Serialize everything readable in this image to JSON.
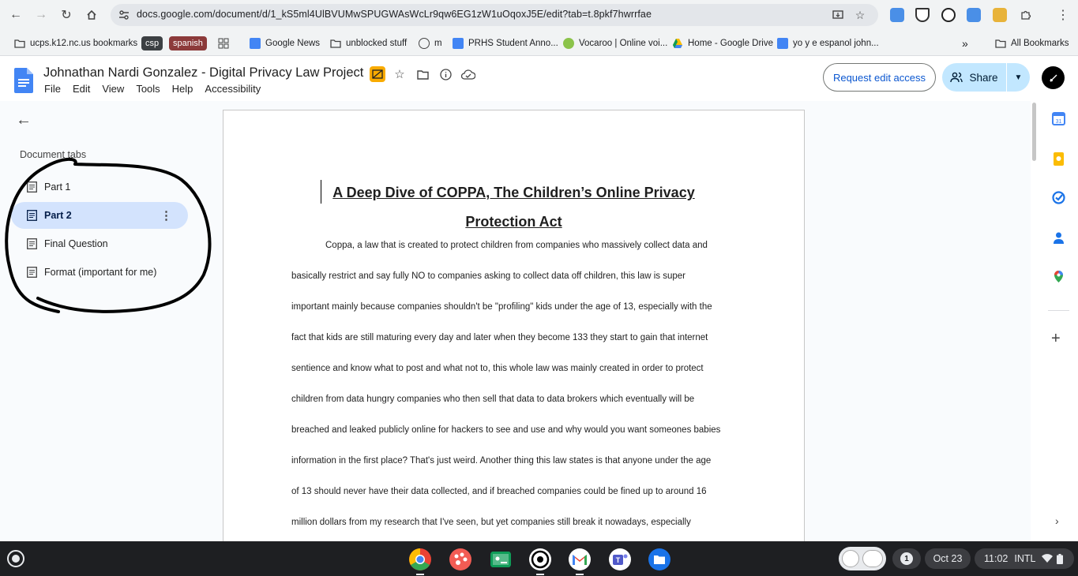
{
  "browser": {
    "url": "docs.google.com/document/d/1_kS5ml4UlBVUMwSPUGWAsWcLr9qw6EG1zW1uOqoxJ5E/edit?tab=t.8pkf7hwrrfae",
    "bookmarks": [
      {
        "label": "ucps.k12.nc.us bookmarks"
      },
      {
        "label": "csp"
      },
      {
        "label": "spanish"
      },
      {
        "label": "Google News"
      },
      {
        "label": "unblocked stuff"
      },
      {
        "label": "m"
      },
      {
        "label": "PRHS Student Anno..."
      },
      {
        "label": "Vocaroo | Online voi..."
      },
      {
        "label": "Home - Google Drive"
      },
      {
        "label": "yo y e espanol john..."
      }
    ],
    "all_bookmarks": "All Bookmarks",
    "overflow": "»"
  },
  "docs": {
    "title": "Johnathan Nardi Gonzalez - Digital Privacy Law Project",
    "menu": [
      "File",
      "Edit",
      "View",
      "Tools",
      "Help",
      "Accessibility"
    ],
    "request_edit": "Request edit access",
    "share": "Share"
  },
  "sidebar": {
    "heading": "Document tabs",
    "tabs": [
      {
        "label": "Part 1",
        "active": false
      },
      {
        "label": "Part 2",
        "active": true
      },
      {
        "label": "Final Question",
        "active": false
      },
      {
        "label": "Format (important for me)",
        "active": false
      }
    ]
  },
  "document": {
    "title_line1": "A Deep Dive of COPPA, The Children’s Online Privacy",
    "title_line2": "Protection Act",
    "lines": [
      "Coppa, a law that is created to protect children from companies who massively collect data and",
      "basically restrict and say fully NO to companies asking to collect data off children, this law is super",
      "important mainly because companies shouldn't be \"profiling\" kids under the age of 13, especially with the",
      "fact that kids are still maturing every day and later when they become 133 they start to gain that internet",
      "sentience and know what to post and what not to, this whole law was mainly created in order to protect",
      "children from data hungry companies who then sell that data to data brokers which eventually will be",
      "breached and leaked publicly online for hackers to see and use and why would you want someones babies",
      "information in the first place? That's just weird. Another thing this law states is that anyone under the age",
      "of 13 should never have their data collected, and if breached companies could be fined up to around 16",
      "million dollars from my research that I've seen, but yet companies still break it nowadays, especially"
    ]
  },
  "taskbar": {
    "notification_count": "1",
    "date": "Oct 23",
    "time": "11:02",
    "input_method": "INTL"
  }
}
